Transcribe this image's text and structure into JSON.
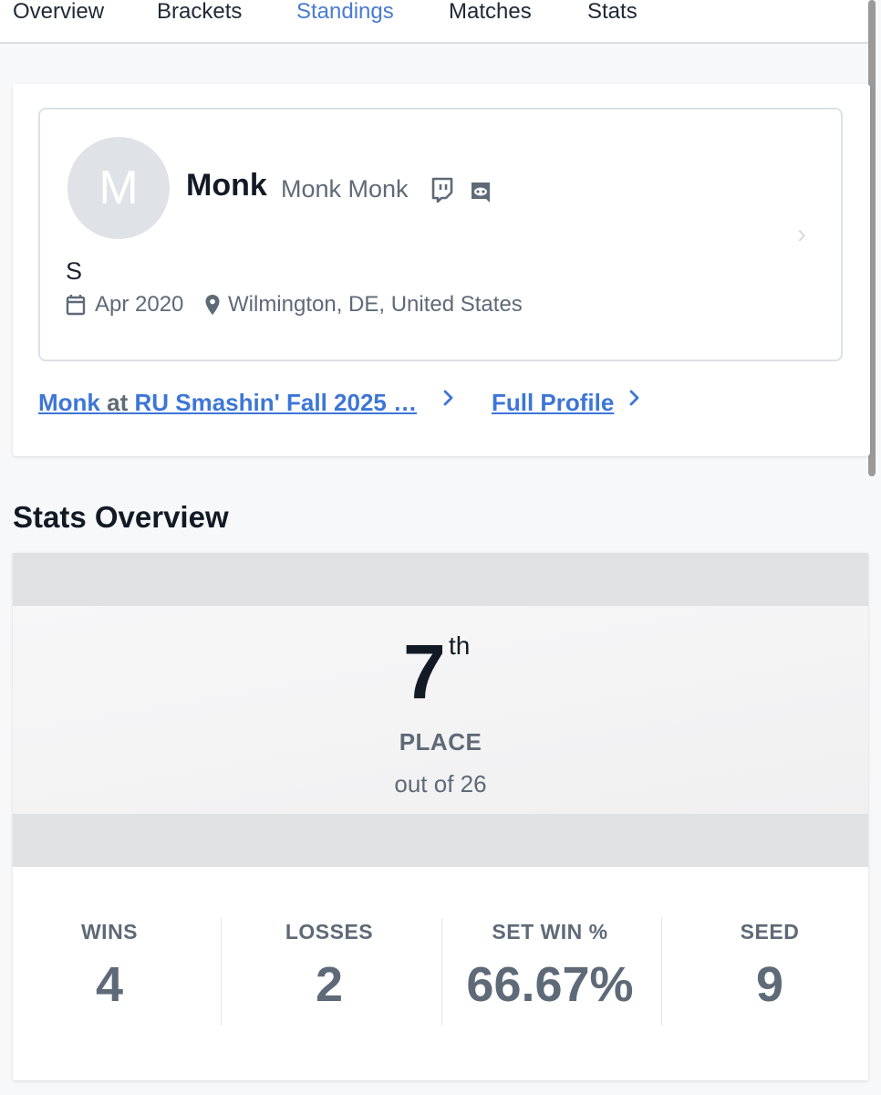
{
  "tabs": [
    {
      "label": "Overview",
      "active": false
    },
    {
      "label": "Brackets",
      "active": false
    },
    {
      "label": "Standings",
      "active": true
    },
    {
      "label": "Matches",
      "active": false
    },
    {
      "label": "Stats",
      "active": false
    }
  ],
  "profile": {
    "avatar_initial": "M",
    "gamer_tag": "Monk",
    "real_name": "Monk Monk",
    "social_icons": [
      "twitch-icon",
      "discord-icon"
    ],
    "tagline": "S",
    "joined": "Apr 2020",
    "location": "Wilmington, DE, United States"
  },
  "links": {
    "event_player": "Monk",
    "event_at": "at",
    "event_name": "RU Smashin' Fall 2025 …",
    "full_profile": "Full Profile"
  },
  "stats_overview": {
    "heading": "Stats Overview",
    "place_number": "7",
    "place_suffix": "th",
    "place_label": "PLACE",
    "place_out_of": "out of 26",
    "items": [
      {
        "label": "WINS",
        "value": "4"
      },
      {
        "label": "LOSSES",
        "value": "2"
      },
      {
        "label": "SET WIN %",
        "value": "66.67%"
      },
      {
        "label": "SEED",
        "value": "9"
      }
    ]
  },
  "colors": {
    "accent": "#3d76d6",
    "active_tab": "#4a7bd0",
    "muted_text": "#5e6a77",
    "dark_text": "#111a25"
  }
}
